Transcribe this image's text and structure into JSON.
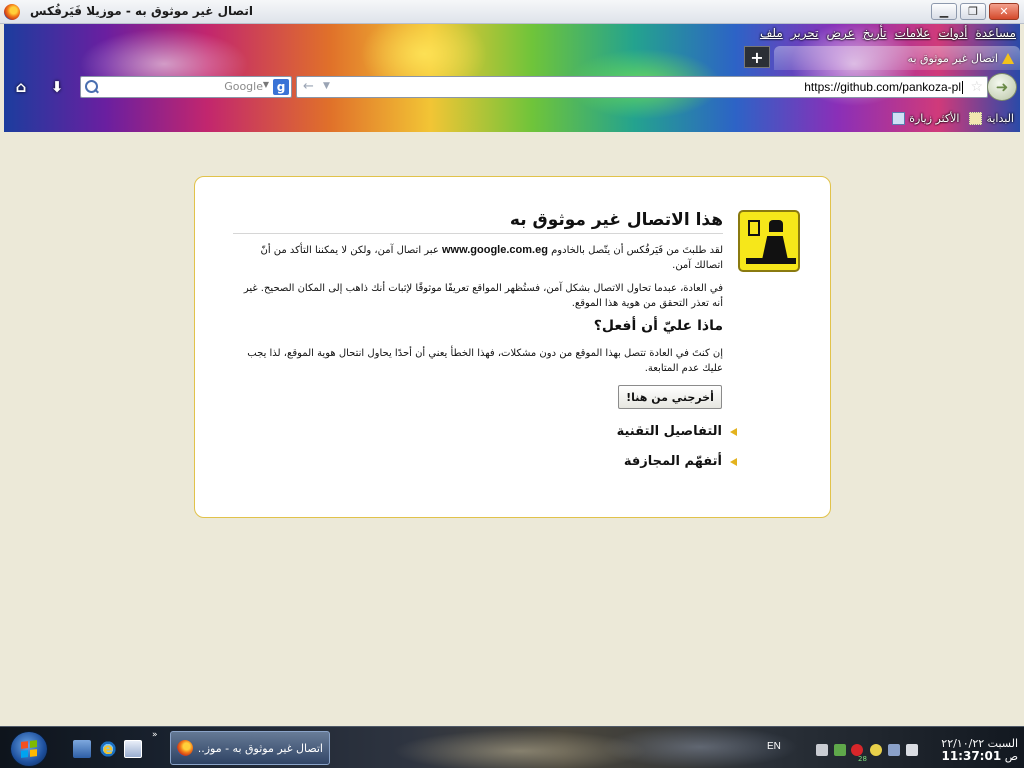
{
  "window": {
    "title": "اتصال غير موثوق به - موزيلا فَيَرفُكس"
  },
  "menu": [
    "ملف",
    "تحرير",
    "عرض",
    "تأريخ",
    "علامات",
    "أدوات",
    "مساعدة"
  ],
  "tab": {
    "label": "اتصال غير موثوق به",
    "new_tab_symbol": "+"
  },
  "search": {
    "engine": "Google",
    "engine_letter": "g"
  },
  "url": {
    "value": "https://github.com/pankoza-pl"
  },
  "bookmarks": [
    "الأكثر زيارة",
    "البداية"
  ],
  "error_page": {
    "title": "هذا الاتصال غير موثوق به",
    "p1_before": "لقد طلبتَ من فَيَرفُكس أن يتّصل بالخادوم",
    "server": "www.google.com.eg",
    "p1_after": "عبر اتصال آمن، ولكن لا يمكننا التأكد من أنّ اتصالك آمن.",
    "p2": "في العادة، عبدما تحاول الاتصال بشكل آمن، فستُظهر المواقع تعريفًا موثوقًا لإثبات أنك ذاهب إلى المكان الصحيح. غير أنه تعذر التحقق من هوية هذا الموقع.",
    "subtitle": "ماذا عليّ أن أفعل؟",
    "p3": "إن كنتَ في العادة تتصل بهذا الموقع من دون مشكلات، فهذا الخطأ يعني أن أحدًا يحاول انتحال هوية الموقع، لذا يجب عليك عدم المتابعة.",
    "button": "أخرجني من هنا!",
    "expanders": [
      "التفاصيل التقنية",
      "أتفهّم المجازفة"
    ]
  },
  "taskbar": {
    "task_label": "اتصال غير موثوق به - موز...",
    "language": "EN",
    "date": "السبت ٢٢/١٠/٢٢",
    "time_suffix": "ص",
    "time": "11:37:01",
    "tray_badge": "28"
  },
  "colors": {
    "error_border": "#e1c24a",
    "warning_yellow": "#f6e71a",
    "content_bg": "#ece9d8"
  }
}
